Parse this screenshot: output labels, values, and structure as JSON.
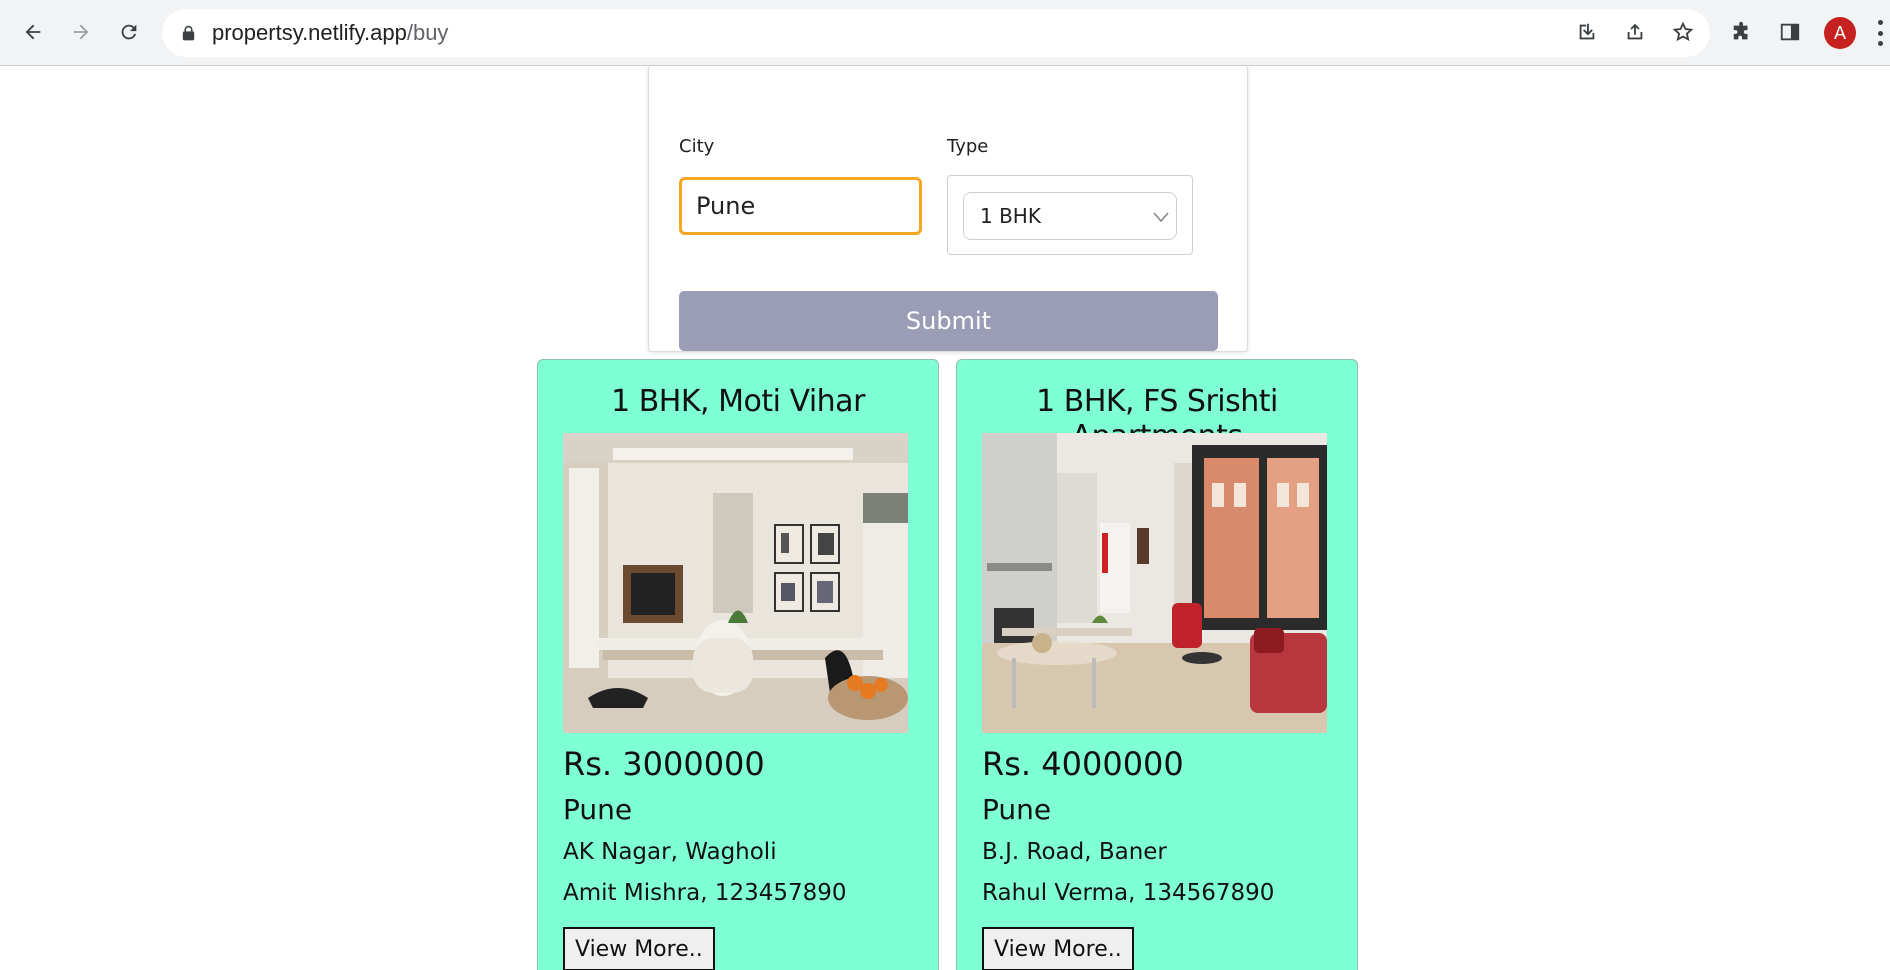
{
  "browser": {
    "url_host": "propertsy.netlify.app",
    "url_path": "/buy",
    "avatar_letter": "A",
    "icons": [
      "back-icon",
      "forward-icon",
      "reload-icon",
      "lock-icon",
      "install-icon",
      "share-icon",
      "star-icon",
      "extensions-icon",
      "side-panel-icon",
      "menu-icon"
    ]
  },
  "form": {
    "city_label": "City",
    "city_value": "Pune",
    "type_label": "Type",
    "type_value": "1 BHK",
    "submit_label": "Submit",
    "input_focus_color": "#f5a623",
    "submit_color": "#9b9db6"
  },
  "listings": [
    {
      "title": "1 BHK, Moti Vihar",
      "price": "Rs. 3000000",
      "city": "Pune",
      "address": "AK Nagar, Wagholi",
      "owner": "Amit Mishra, 123457890",
      "button": "View More.."
    },
    {
      "title": "1 BHK, FS Srishti Apartments",
      "price": "Rs. 4000000",
      "city": "Pune",
      "address": "B.J. Road, Baner",
      "owner": "Rahul Verma, 134567890",
      "button": "View More.."
    }
  ],
  "card_color": "#7fffd4"
}
